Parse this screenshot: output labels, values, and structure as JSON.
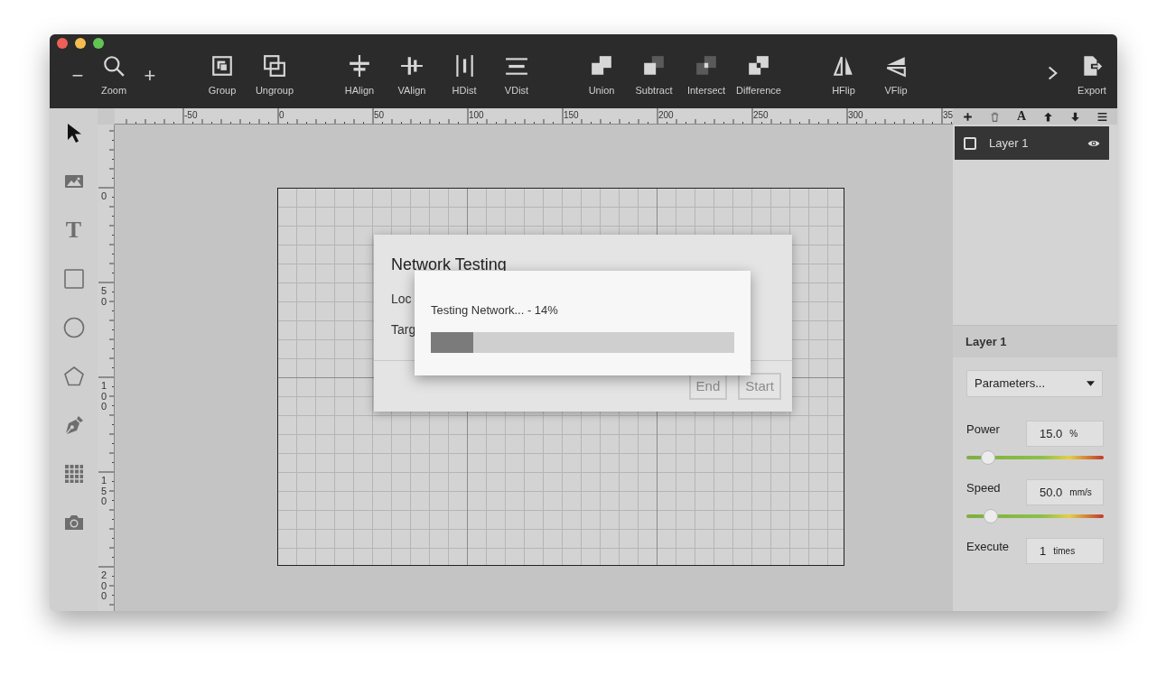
{
  "window": {
    "traffic_lights": [
      {
        "color": "#ee5f57"
      },
      {
        "color": "#f5bd4f"
      },
      {
        "color": "#61c454"
      }
    ]
  },
  "toolbar": {
    "zoom": {
      "minus": "−",
      "label": "Zoom",
      "plus": "+"
    },
    "groups": [
      [
        {
          "label": "Group"
        },
        {
          "label": "Ungroup"
        }
      ],
      [
        {
          "label": "HAlign"
        },
        {
          "label": "VAlign"
        },
        {
          "label": "HDist"
        },
        {
          "label": "VDist"
        }
      ],
      [
        {
          "label": "Union"
        },
        {
          "label": "Subtract"
        },
        {
          "label": "Intersect"
        },
        {
          "label": "Difference"
        }
      ],
      [
        {
          "label": "HFlip"
        },
        {
          "label": "VFlip"
        }
      ]
    ],
    "export": {
      "label": "Export"
    }
  },
  "left_tools": [
    {
      "kind": "icon",
      "selected": true
    },
    {
      "kind": "icon",
      "selected": false
    },
    {
      "kind": "glyph",
      "glyph": "T",
      "selected": false
    },
    {
      "kind": "icon",
      "selected": false
    },
    {
      "kind": "icon",
      "selected": false
    },
    {
      "kind": "icon",
      "selected": false
    },
    {
      "kind": "icon",
      "selected": false
    },
    {
      "kind": "icon",
      "selected": false
    },
    {
      "kind": "icon",
      "selected": false
    }
  ],
  "rulers": {
    "horizontal": [
      "-50",
      "0",
      "50",
      "100",
      "150",
      "200",
      "250",
      "300",
      "35"
    ],
    "vertical": [
      "0",
      "50",
      "100",
      "150",
      "200"
    ]
  },
  "dialog": {
    "title": "Network Testing",
    "fields": [
      "Loc",
      "Targ"
    ],
    "buttons": [
      {
        "label": "End",
        "disabled": true
      },
      {
        "label": "Start",
        "disabled": true
      }
    ]
  },
  "progress": {
    "message": "Testing Network... - 14%",
    "level": 0.14
  },
  "layers_toolbar": [
    {
      "kind": "icon"
    },
    {
      "kind": "icon"
    },
    {
      "kind": "glyph",
      "glyph": "A"
    },
    {
      "kind": "icon"
    },
    {
      "kind": "icon"
    },
    {
      "kind": "icon"
    }
  ],
  "layers": [
    {
      "name": "Layer 1",
      "selected": true,
      "checked": false,
      "visible": true
    }
  ],
  "properties": {
    "title": "Layer 1",
    "preset": "Parameters...",
    "power": {
      "label": "Power",
      "value": "15.0",
      "unit": "%",
      "level": 0.16
    },
    "speed": {
      "label": "Speed",
      "value": "50.0",
      "unit": "mm/s",
      "level": 0.18
    },
    "execute": {
      "label": "Execute",
      "value": "1",
      "unit": "times"
    }
  }
}
